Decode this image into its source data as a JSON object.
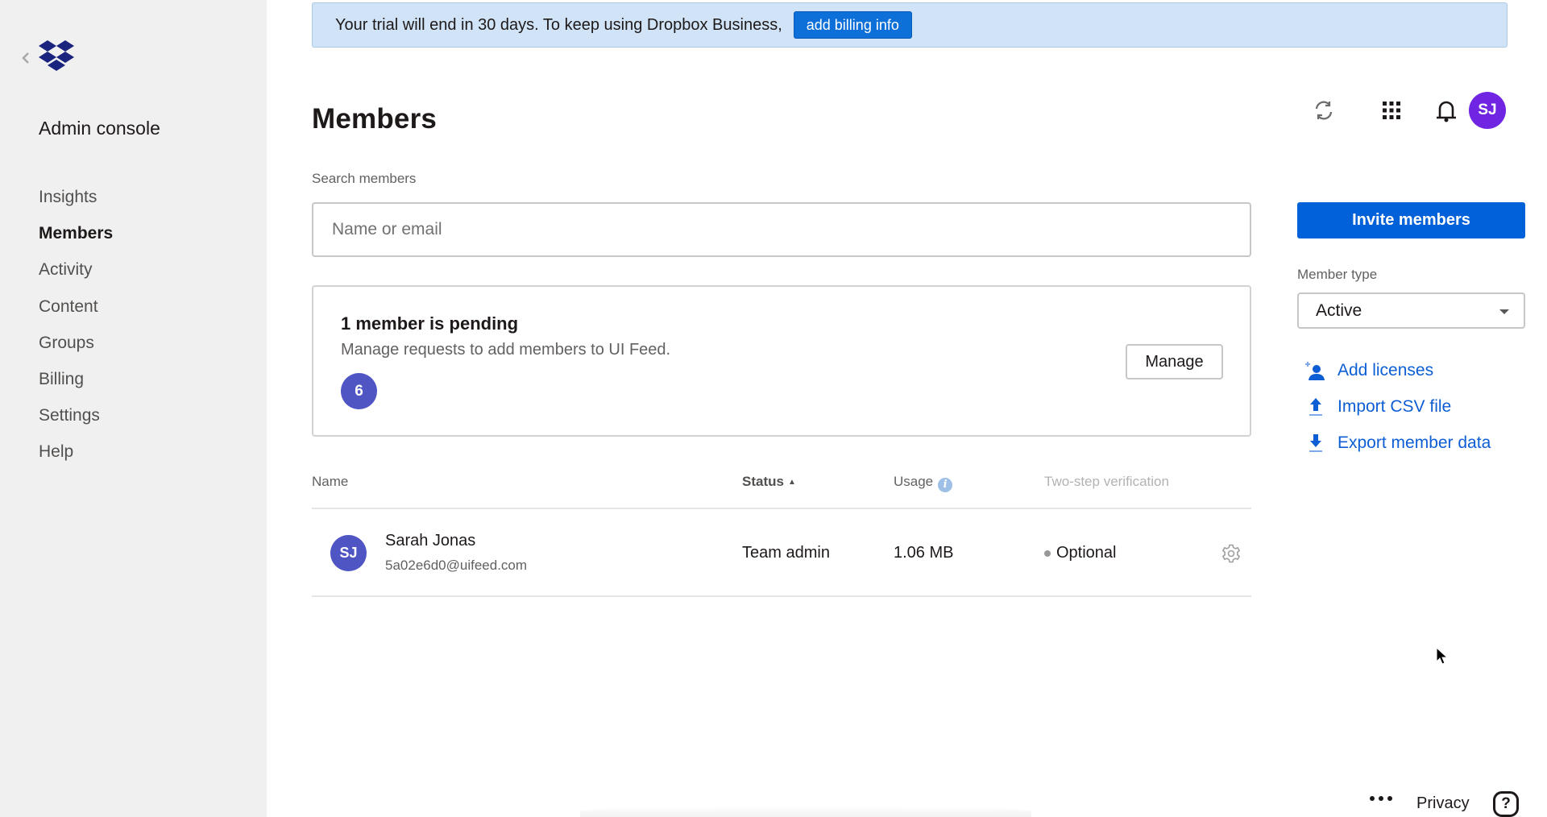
{
  "sidebar": {
    "back_icon": "chevron-left-icon",
    "logo": "dropbox-logo",
    "title": "Admin console",
    "items": [
      {
        "label": "Insights",
        "active": false
      },
      {
        "label": "Members",
        "active": true
      },
      {
        "label": "Activity",
        "active": false
      },
      {
        "label": "Content",
        "active": false
      },
      {
        "label": "Groups",
        "active": false
      },
      {
        "label": "Billing",
        "active": false
      },
      {
        "label": "Settings",
        "active": false
      },
      {
        "label": "Help",
        "active": false
      }
    ]
  },
  "banner": {
    "text": "Your trial will end in 30 days. To keep using Dropbox Business,",
    "button_label": "add billing info"
  },
  "header": {
    "title": "Members",
    "icons": [
      "sync-icon",
      "app-grid-icon",
      "bell-icon"
    ],
    "avatar_initials": "SJ",
    "avatar_color": "#7025e3"
  },
  "search": {
    "label": "Search members",
    "placeholder": "Name or email",
    "value": ""
  },
  "pending": {
    "title": "1 member is pending",
    "subtitle": "Manage requests to add members to UI Feed.",
    "badge": "6",
    "manage_label": "Manage"
  },
  "actions": {
    "invite_label": "Invite members",
    "member_type_label": "Member type",
    "member_type_value": "Active",
    "links": [
      {
        "label": "Add licenses",
        "icon": "add-person-icon"
      },
      {
        "label": "Import CSV file",
        "icon": "upload-icon"
      },
      {
        "label": "Export member data",
        "icon": "download-icon"
      }
    ]
  },
  "table": {
    "columns": {
      "name": "Name",
      "status": "Status",
      "usage": "Usage",
      "two_step": "Two-step verification"
    },
    "sort": {
      "column": "status",
      "direction": "ascending"
    },
    "rows": [
      {
        "initials": "SJ",
        "name": "Sarah Jonas",
        "email": "5a02e6d0@uifeed.com",
        "status": "Team admin",
        "usage": "1.06 MB",
        "two_step": "Optional"
      }
    ]
  },
  "footer": {
    "privacy_label": "Privacy",
    "help_label": "?"
  },
  "colors": {
    "primary": "#0061d9",
    "link": "#0d5ed4",
    "banner_bg": "#d0e3f7",
    "avatar_indigo": "#4f56c4",
    "logo": "#1a237e"
  }
}
